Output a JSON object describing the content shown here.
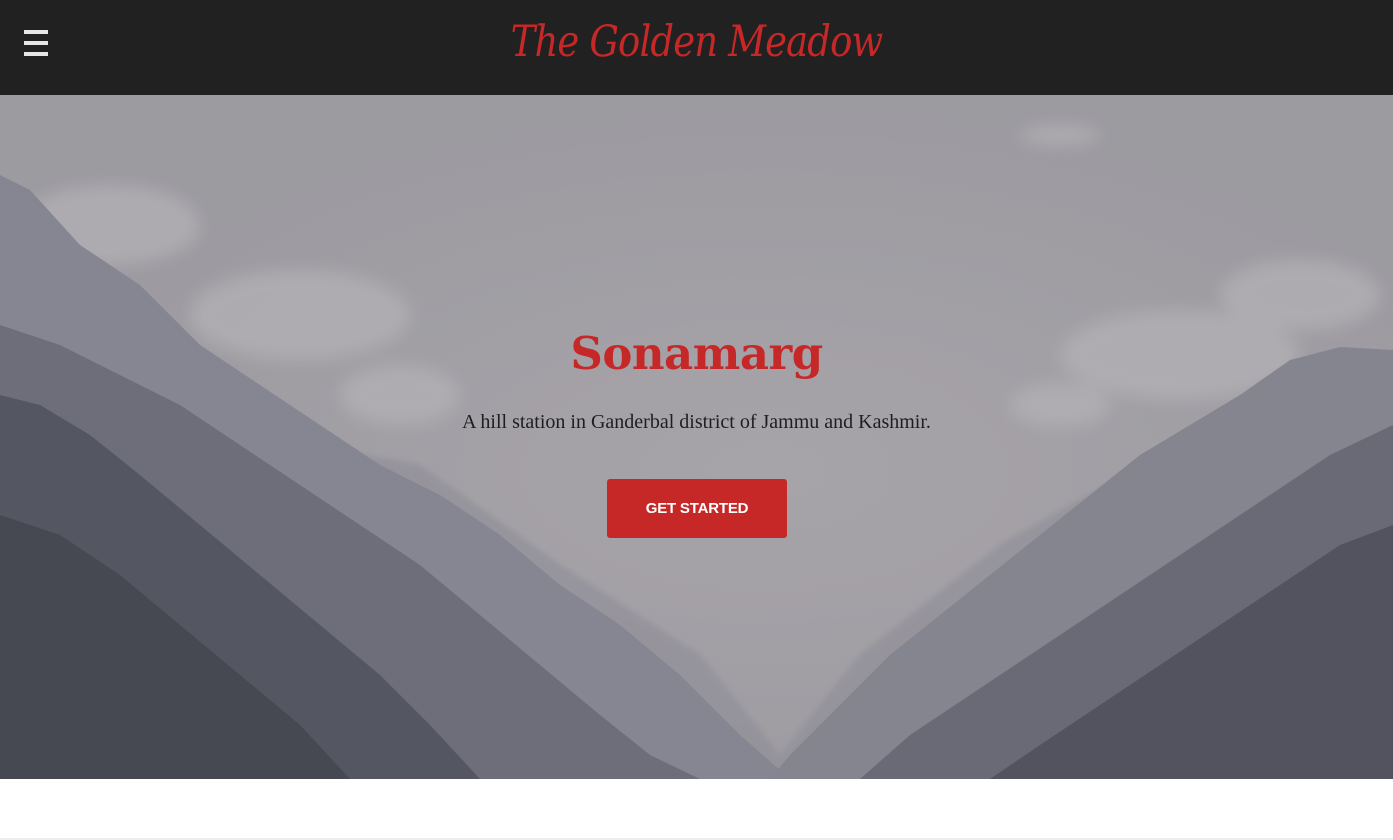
{
  "header": {
    "menu_icon": "hamburger-menu-icon",
    "brand": "The Golden Meadow",
    "background": "#212121",
    "brand_color": "#c62828"
  },
  "hero": {
    "title": "Sonamarg",
    "subtitle": "A hill station in Ganderbal district of Jammu and Kashmir.",
    "cta_label": "GET STARTED",
    "accent_color": "#c62828"
  }
}
